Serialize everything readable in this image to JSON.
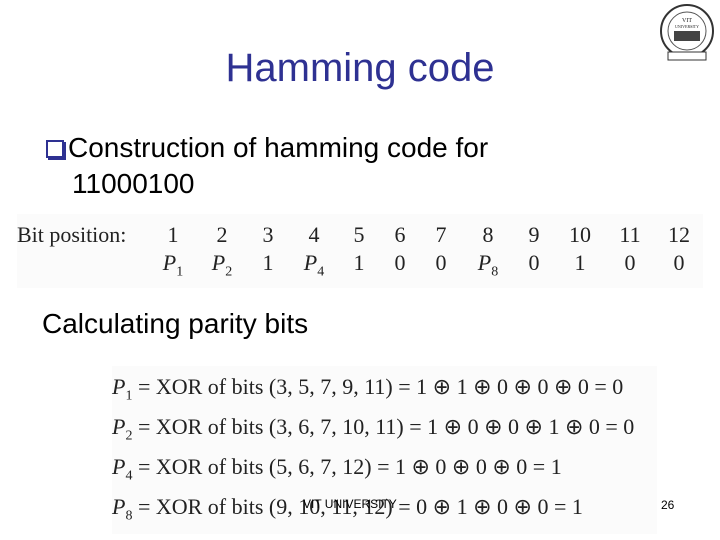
{
  "slide": {
    "title": "Hamming code",
    "logo_text": "VIT UNIVERSITY",
    "bullet": "Construction of hamming code for",
    "bullet_cont": "11000100",
    "subheading": "Calculating parity bits",
    "footer": "VIT UNIVERSITY",
    "page_number": "26"
  },
  "bit_table": {
    "label": "Bit position:",
    "positions": [
      "1",
      "2",
      "3",
      "4",
      "5",
      "6",
      "7",
      "8",
      "9",
      "10",
      "11",
      "12"
    ],
    "values": [
      {
        "p": "P",
        "sub": "1"
      },
      {
        "p": "P",
        "sub": "2"
      },
      {
        "v": "1"
      },
      {
        "p": "P",
        "sub": "4"
      },
      {
        "v": "1"
      },
      {
        "v": "0"
      },
      {
        "v": "0"
      },
      {
        "p": "P",
        "sub": "8"
      },
      {
        "v": "0"
      },
      {
        "v": "1"
      },
      {
        "v": "0"
      },
      {
        "v": "0"
      }
    ]
  },
  "equations": [
    {
      "parity": "P",
      "sub": "1",
      "text": " = XOR of bits (3, 5, 7, 9, 11) = 1 ⊕ 1 ⊕ 0 ⊕ 0 ⊕ 0 = 0"
    },
    {
      "parity": "P",
      "sub": "2",
      "text": " = XOR of bits (3, 6, 7, 10, 11) = 1 ⊕ 0 ⊕ 0 ⊕ 1 ⊕ 0 = 0"
    },
    {
      "parity": "P",
      "sub": "4",
      "text": " = XOR of bits (5, 6, 7, 12) = 1 ⊕ 0 ⊕ 0 ⊕ 0 = 1"
    },
    {
      "parity": "P",
      "sub": "8",
      "text": " = XOR of bits (9, 10, 11, 12) = 0 ⊕ 1 ⊕ 0 ⊕ 0 = 1"
    }
  ]
}
